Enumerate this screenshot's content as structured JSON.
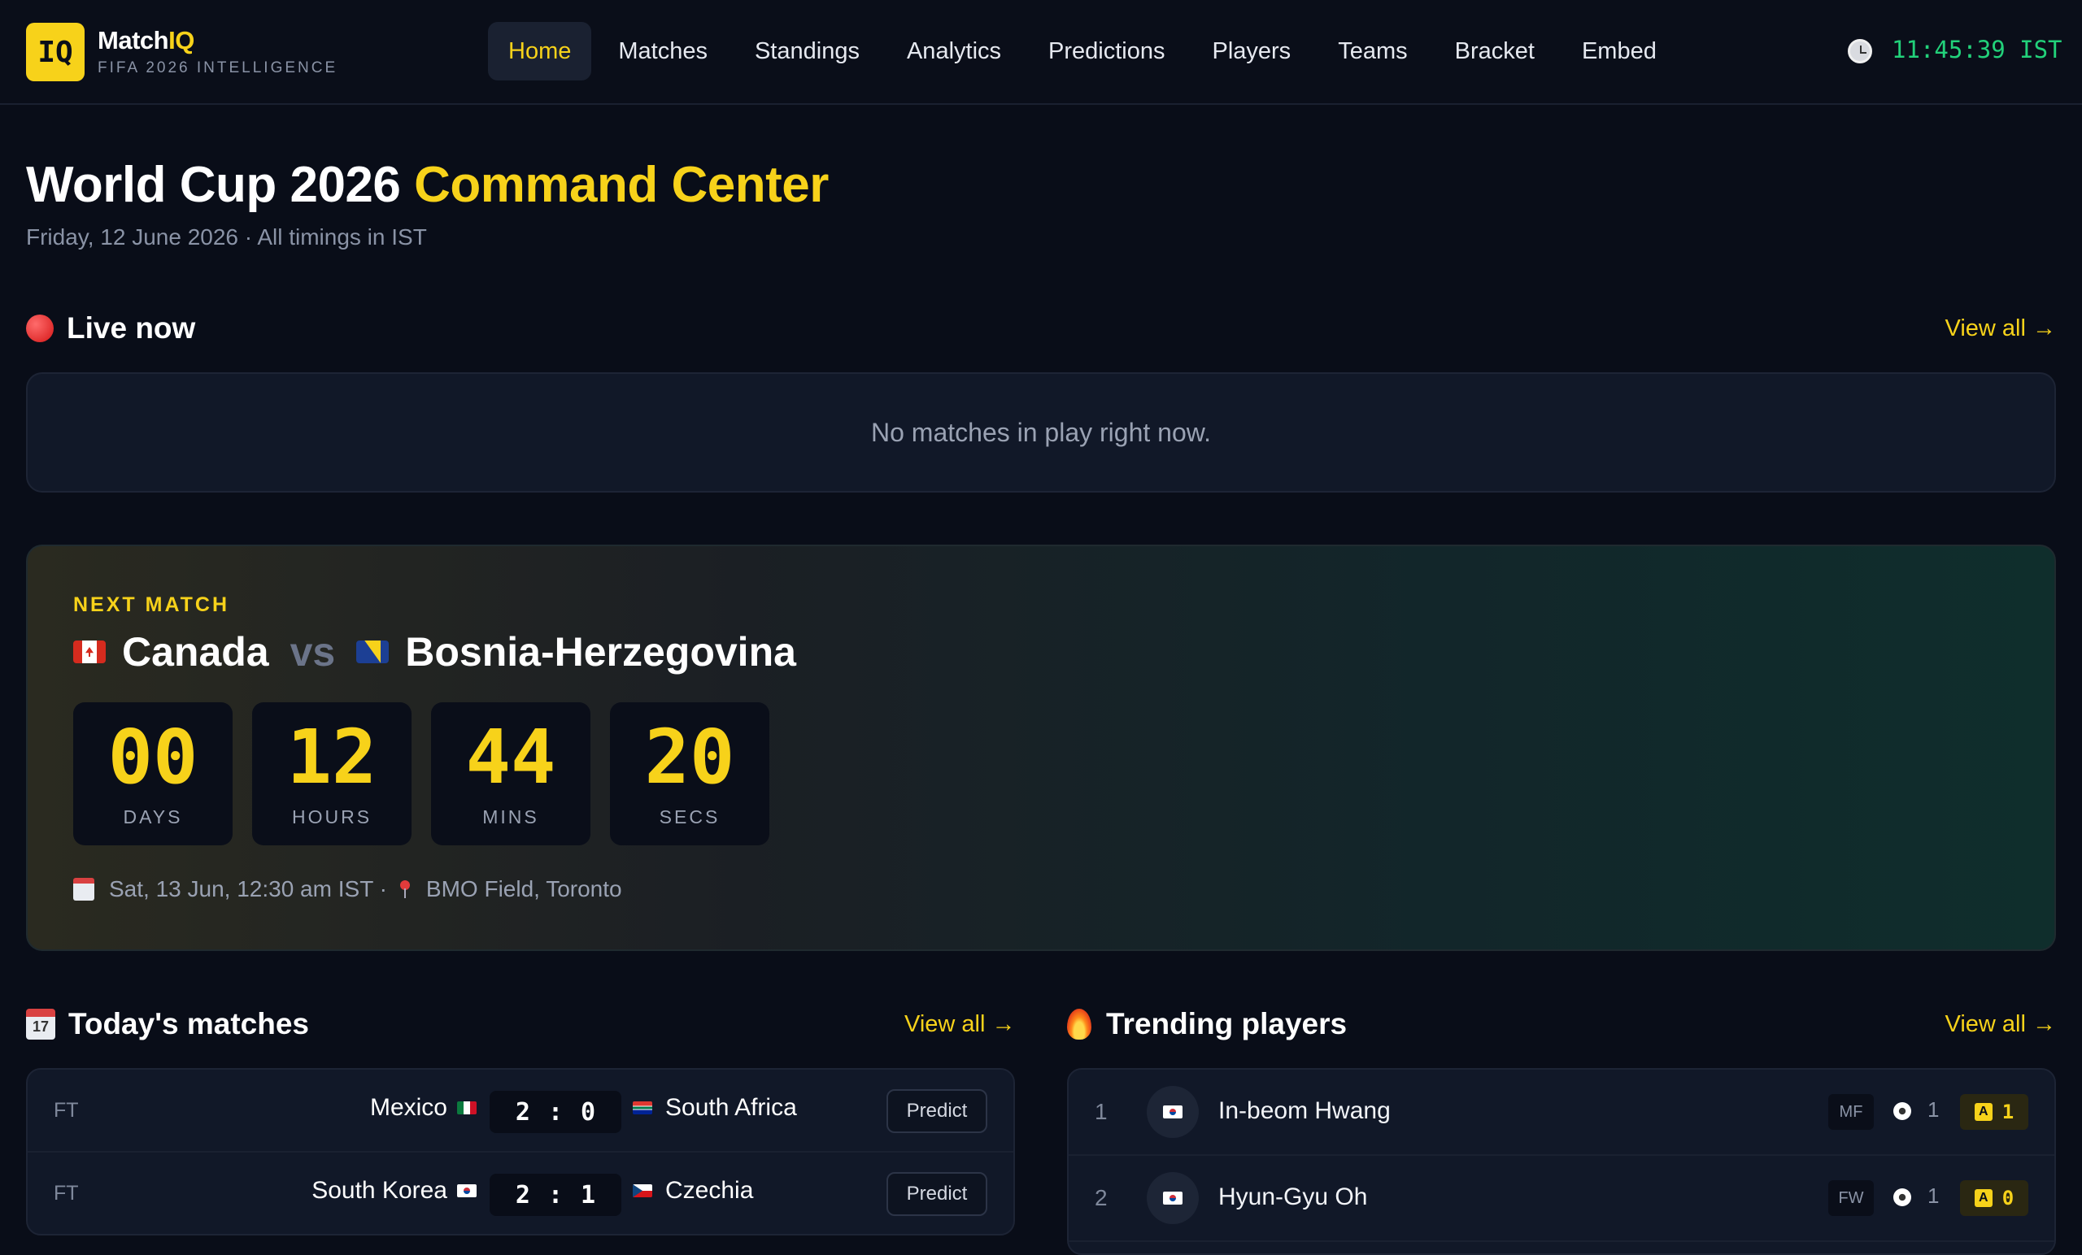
{
  "brand": {
    "logo": "IQ",
    "name_main": "Match",
    "name_accent": "IQ",
    "subtitle": "FIFA 2026 INTELLIGENCE"
  },
  "nav": [
    {
      "label": "Home",
      "active": true
    },
    {
      "label": "Matches"
    },
    {
      "label": "Standings"
    },
    {
      "label": "Analytics"
    },
    {
      "label": "Predictions"
    },
    {
      "label": "Players"
    },
    {
      "label": "Teams"
    },
    {
      "label": "Bracket"
    },
    {
      "label": "Embed"
    }
  ],
  "clock": {
    "icon": "clock-icon",
    "time": "11:45:39 IST"
  },
  "header": {
    "title_main": "World Cup 2026",
    "title_accent": "Command Center",
    "subtitle": "Friday, 12 June 2026 · All timings in IST"
  },
  "live": {
    "title": "Live now",
    "icon": "red-circle-icon",
    "view_all": "View all →",
    "empty": "No matches in play right now."
  },
  "next_match": {
    "label": "NEXT MATCH",
    "home": "Canada",
    "vs": "vs",
    "away": "Bosnia-Herzegovina",
    "countdown": [
      {
        "value": "00",
        "label": "DAYS"
      },
      {
        "value": "12",
        "label": "HOURS"
      },
      {
        "value": "44",
        "label": "MINS"
      },
      {
        "value": "20",
        "label": "SECS"
      }
    ],
    "datetime": "Sat, 13 Jun, 12:30 am IST ·",
    "venue": "BMO Field, Toronto"
  },
  "today": {
    "title": "Today's matches",
    "icon": "calendar-icon",
    "view_all": "View all →",
    "matches": [
      {
        "status": "FT",
        "home": "Mexico",
        "home_score": "2",
        "sep": ":",
        "away_score": "0",
        "away": "South Africa",
        "action": "Predict"
      },
      {
        "status": "FT",
        "home": "South Korea",
        "home_score": "2",
        "sep": ":",
        "away_score": "1",
        "away": "Czechia",
        "action": "Predict"
      }
    ]
  },
  "trending": {
    "title": "Trending players",
    "icon": "fire-icon",
    "view_all": "View all →",
    "players": [
      {
        "rank": "1",
        "name": "In-beom Hwang",
        "position": "MF",
        "goals": "1",
        "assist_icon": "A",
        "assists": "1"
      },
      {
        "rank": "2",
        "name": "Hyun-Gyu Oh",
        "position": "FW",
        "goals": "1",
        "assist_icon": "A",
        "assists": "0"
      }
    ]
  },
  "colors": {
    "accent": "#f7d21a",
    "background": "#090d18",
    "card": "#111828",
    "clock": "#22d17a"
  }
}
